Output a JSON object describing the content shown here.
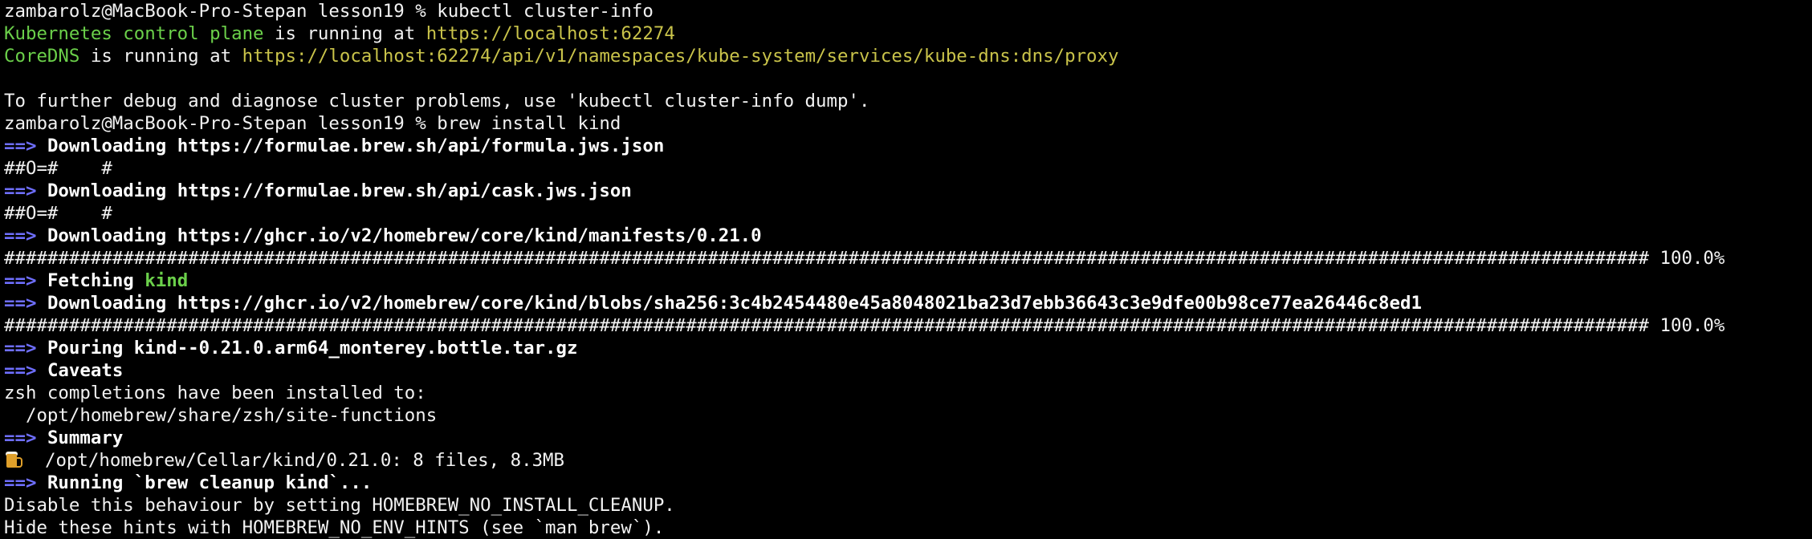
{
  "terminal": {
    "prompt_1": "zambarolz@MacBook-Pro-Stepan lesson19 % ",
    "command_1": "kubectl cluster-info",
    "k8s_label": "Kubernetes control plane",
    "k8s_mid": " is running at ",
    "k8s_url": "https://localhost:62274",
    "dns_label": "CoreDNS",
    "dns_mid": " is running at ",
    "dns_url": "https://localhost:62274/api/v1/namespaces/kube-system/services/kube-dns:dns/proxy",
    "debug_hint": "To further debug and diagnose cluster problems, use 'kubectl cluster-info dump'.",
    "prompt_2": "zambarolz@MacBook-Pro-Stepan lesson19 % ",
    "command_2": "brew install kind",
    "arrow": "==>",
    "dl_formula": "Downloading https://formulae.brew.sh/api/formula.jws.json",
    "progress_small_1": "##O=#    #",
    "dl_cask": "Downloading https://formulae.brew.sh/api/cask.jws.json",
    "progress_small_2": "##O=#    #",
    "dl_manifest": "Downloading https://ghcr.io/v2/homebrew/core/kind/manifests/0.21.0",
    "progress_full_1": "######################################################################################################################################################## 100.0%",
    "fetching_label": "Fetching ",
    "fetching_pkg": "kind",
    "dl_blob": "Downloading https://ghcr.io/v2/homebrew/core/kind/blobs/sha256:3c4b2454480e45a8048021ba23d7ebb36643c3e9dfe00b98ce77ea26446c8ed1",
    "progress_full_2": "######################################################################################################################################################## 100.0%",
    "pouring": "Pouring kind--0.21.0.arm64_monterey.bottle.tar.gz",
    "caveats": "Caveats",
    "zsh_note": "zsh completions have been installed to:",
    "zsh_path": "  /opt/homebrew/share/zsh/site-functions",
    "summary": "Summary",
    "summary_line": "  /opt/homebrew/Cellar/kind/0.21.0: 8 files, 8.3MB",
    "cleanup": "Running `brew cleanup kind`...",
    "cleanup_hint": "Disable this behaviour by setting HOMEBREW_NO_INSTALL_CLEANUP.",
    "env_hint": "Hide these hints with HOMEBREW_NO_ENV_HINTS (see `man brew`)."
  },
  "colors": {
    "background": "#000000",
    "text": "#f2f2f2",
    "arrow": "#6f6fff",
    "green": "#6bd04a",
    "yellow": "#c9c34a"
  },
  "icons": {
    "summary_icon": "beer-mug-icon"
  }
}
